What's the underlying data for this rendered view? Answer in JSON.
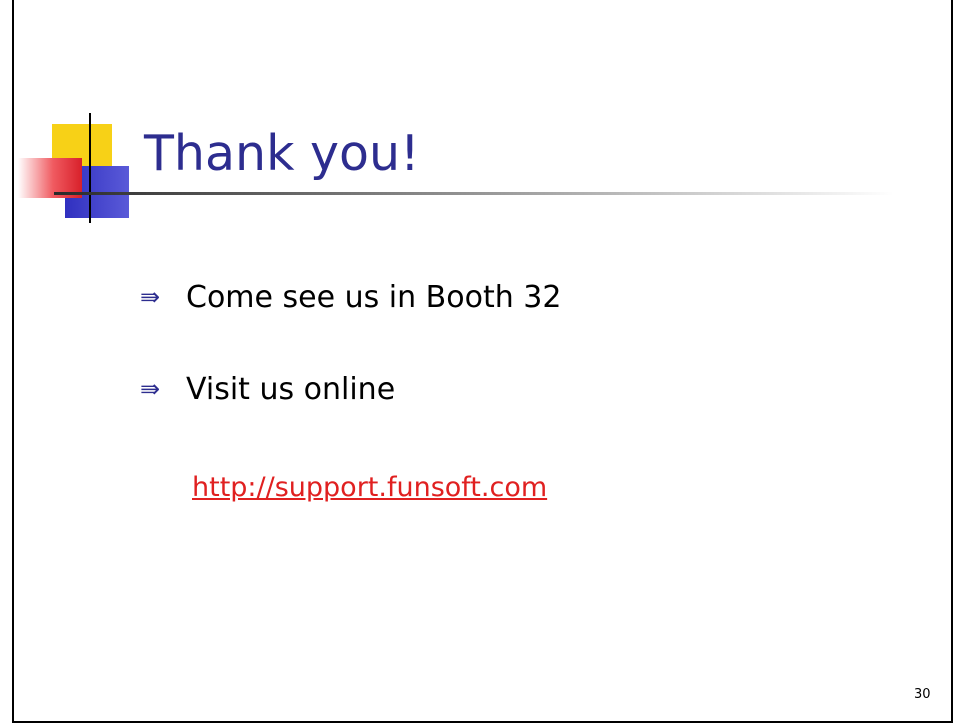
{
  "slide": {
    "title": "Thank you!",
    "bullets": [
      {
        "icon": "double-arrow-icon",
        "text": "Come see us in Booth 32"
      },
      {
        "icon": "double-arrow-icon",
        "text": "Visit us online"
      }
    ],
    "link": "http://support.funsoft.com",
    "page_number": "30"
  },
  "colors": {
    "title": "#2d2d8f",
    "link": "#e02020",
    "logo_yellow": "#f7d117",
    "logo_red": "#e8303a",
    "logo_blue": "#3a3ac9"
  }
}
